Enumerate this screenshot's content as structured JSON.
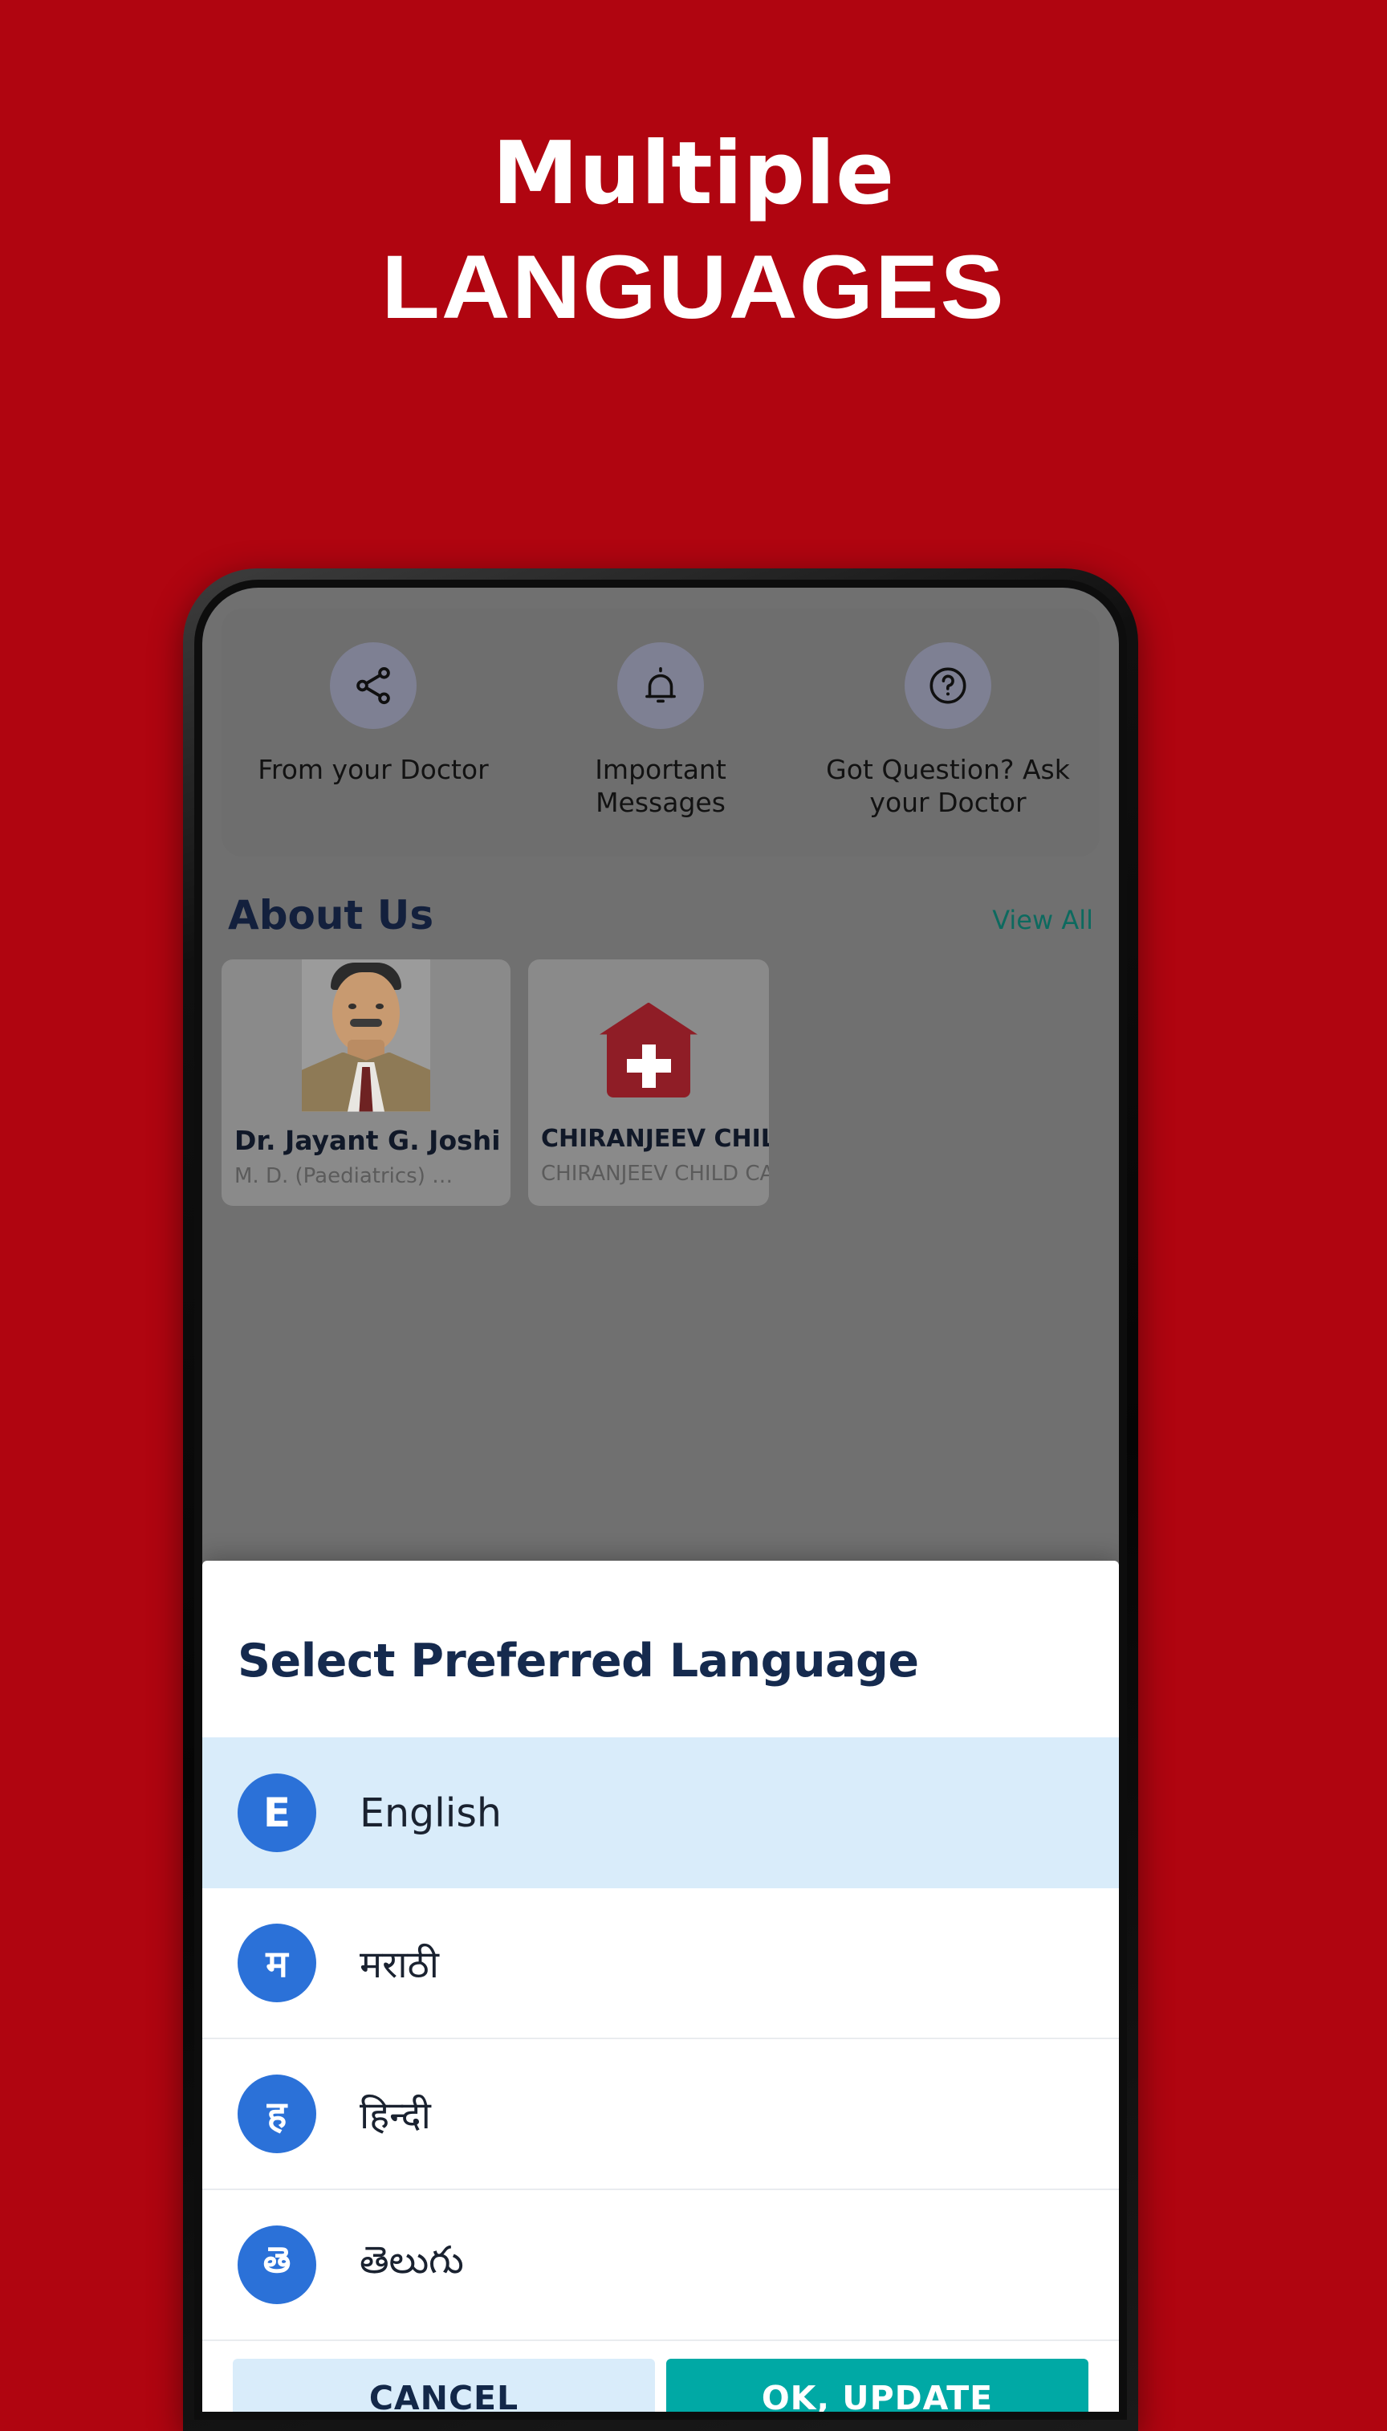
{
  "promo": {
    "background_color": "#B00510",
    "headline_line1": "Multiple",
    "headline_line2": "LANGUAGES"
  },
  "app": {
    "quick_actions": [
      {
        "icon": "share-icon",
        "label": "From your Doctor"
      },
      {
        "icon": "bell-icon",
        "label": "Important\nMessages"
      },
      {
        "icon": "question-circle-icon",
        "label": "Got Question? Ask\nyour Doctor"
      }
    ],
    "quick_action_labels": {
      "share": "From your Doctor",
      "bell_line1": "Important",
      "bell_line2": "Messages",
      "help_line1": "Got Question? Ask",
      "help_line2": "your Doctor"
    },
    "about": {
      "title": "About Us",
      "view_all": "View All",
      "view_all_color": "#0d6a5f",
      "cards": [
        {
          "media": "doctor-portrait",
          "title": "Dr. Jayant G. Joshi",
          "subtitle": "M. D. (Paediatrics)  …"
        },
        {
          "media": "hospital-icon",
          "title": "CHIRANJEEV CHILD C…",
          "subtitle": "CHIRANJEEV CHILD CARE …"
        }
      ]
    }
  },
  "dialog": {
    "title": "Select Preferred Language",
    "selected_row_color": "#d9ecfa",
    "avatar_color": "#2b71d8",
    "languages": [
      {
        "initial": "E",
        "label": "English",
        "selected": true
      },
      {
        "initial": "म",
        "label": "मराठी",
        "selected": false
      },
      {
        "initial": "ह",
        "label": "हिन्दी",
        "selected": false
      },
      {
        "initial": "తె",
        "label": "తెలుగు",
        "selected": false
      }
    ],
    "buttons": {
      "cancel": "CANCEL",
      "confirm": "OK, UPDATE",
      "confirm_color": "#00a9a5"
    }
  }
}
